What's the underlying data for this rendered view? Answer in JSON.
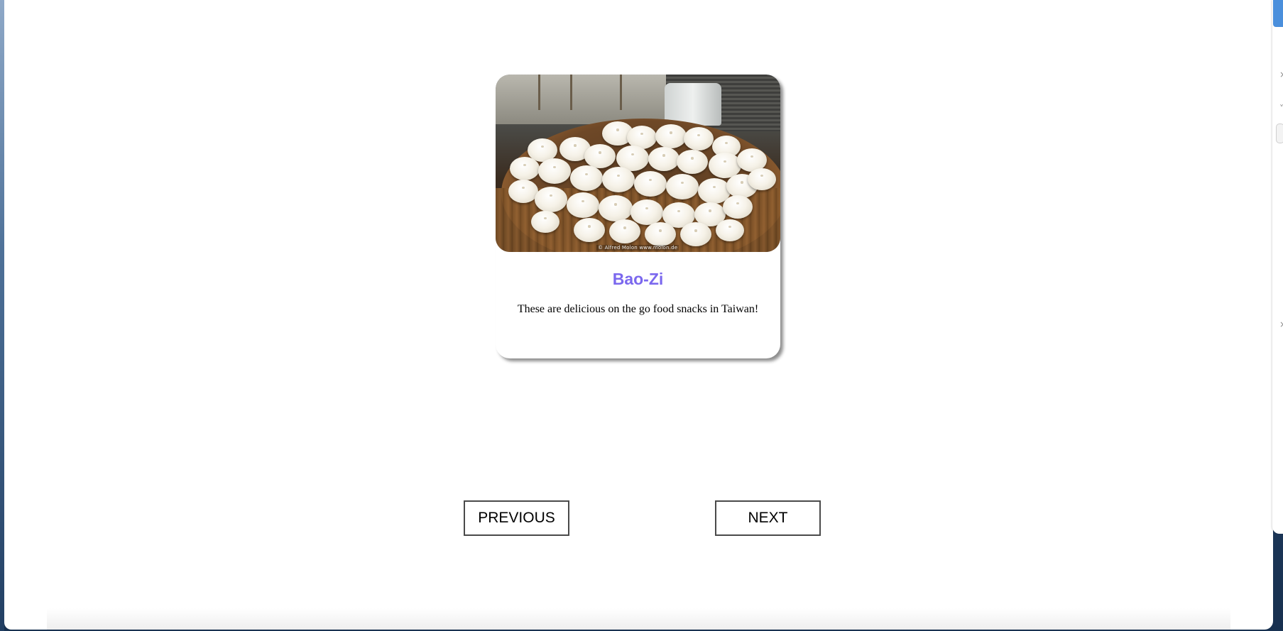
{
  "card": {
    "title": "Bao-Zi",
    "description": "These are delicious on the go food snacks in Taiwan!",
    "image_watermark": "© Alfred Molon     www.molon.de",
    "title_color": "#7b68ee"
  },
  "nav": {
    "previous_label": "PREVIOUS",
    "next_label": "NEXT"
  },
  "side_window": {
    "close_glyph": "×",
    "chevron_glyph": "˅",
    "accent_color": "#4a8fdc"
  }
}
